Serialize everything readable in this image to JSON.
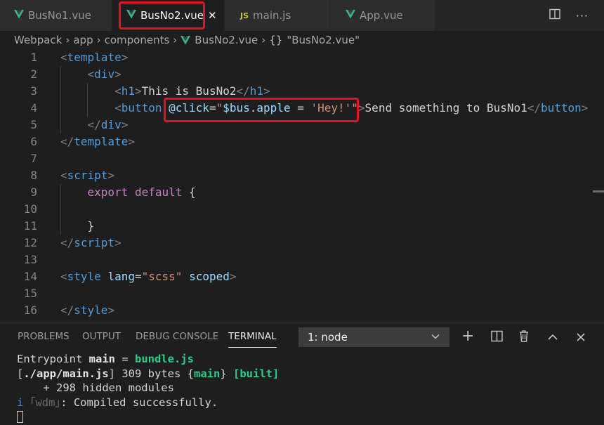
{
  "tabs": [
    {
      "label": "BusNo1.vue",
      "icon": "vue-icon",
      "active": false
    },
    {
      "label": "BusNo2.vue",
      "icon": "vue-icon",
      "active": true,
      "close": "✕"
    },
    {
      "label": "main.js",
      "icon": "js-icon",
      "icon_text": "JS",
      "active": false
    },
    {
      "label": "App.vue",
      "icon": "vue-icon",
      "active": false
    }
  ],
  "tab_actions": {
    "split": "split-editor-icon",
    "more": "···"
  },
  "breadcrumb": {
    "items": [
      "Webpack",
      "app",
      "components",
      "BusNo2.vue"
    ],
    "symbol": "\"BusNo2.vue\"",
    "symbol_icon": "{}",
    "separator": "›"
  },
  "editor": {
    "lines": [
      {
        "n": "1",
        "parts": [
          [
            "punc",
            "<"
          ],
          [
            "tag",
            "template"
          ],
          [
            "punc",
            ">"
          ]
        ]
      },
      {
        "n": "2",
        "parts": [
          [
            "txt",
            "    "
          ],
          [
            "punc",
            "<"
          ],
          [
            "tag",
            "div"
          ],
          [
            "punc",
            ">"
          ]
        ]
      },
      {
        "n": "3",
        "parts": [
          [
            "txt",
            "        "
          ],
          [
            "punc",
            "<"
          ],
          [
            "tag",
            "h1"
          ],
          [
            "punc",
            ">"
          ],
          [
            "txt",
            "This is BusNo2"
          ],
          [
            "punc",
            "</"
          ],
          [
            "tag",
            "h1"
          ],
          [
            "punc",
            ">"
          ]
        ]
      },
      {
        "n": "4",
        "parts": [
          [
            "txt",
            "        "
          ],
          [
            "punc",
            "<"
          ],
          [
            "tag",
            "button"
          ],
          [
            "txt",
            " "
          ],
          [
            "attr",
            "@click"
          ],
          [
            "txt",
            "="
          ],
          [
            "str",
            "\""
          ],
          [
            "attr",
            "$bus"
          ],
          [
            "txt",
            "."
          ],
          [
            "attr",
            "apple"
          ],
          [
            "txt",
            " = "
          ],
          [
            "str",
            "'Hey!'"
          ],
          [
            "str",
            "\""
          ],
          [
            "punc",
            ">"
          ],
          [
            "txt",
            "Send something to BusNo1"
          ],
          [
            "punc",
            "</"
          ],
          [
            "tag",
            "button"
          ],
          [
            "punc",
            ">"
          ]
        ]
      },
      {
        "n": "5",
        "parts": [
          [
            "txt",
            "    "
          ],
          [
            "punc",
            "</"
          ],
          [
            "tag",
            "div"
          ],
          [
            "punc",
            ">"
          ]
        ]
      },
      {
        "n": "6",
        "parts": [
          [
            "punc",
            "</"
          ],
          [
            "tag",
            "template"
          ],
          [
            "punc",
            ">"
          ]
        ]
      },
      {
        "n": "7",
        "parts": []
      },
      {
        "n": "8",
        "parts": [
          [
            "punc",
            "<"
          ],
          [
            "tag",
            "script"
          ],
          [
            "punc",
            ">"
          ]
        ]
      },
      {
        "n": "9",
        "parts": [
          [
            "txt",
            "    "
          ],
          [
            "kw",
            "export"
          ],
          [
            "txt",
            " "
          ],
          [
            "kw",
            "default"
          ],
          [
            "txt",
            " {"
          ]
        ]
      },
      {
        "n": "10",
        "parts": []
      },
      {
        "n": "11",
        "parts": [
          [
            "txt",
            "    }"
          ]
        ]
      },
      {
        "n": "12",
        "parts": [
          [
            "punc",
            "</"
          ],
          [
            "tag",
            "script"
          ],
          [
            "punc",
            ">"
          ]
        ]
      },
      {
        "n": "13",
        "parts": []
      },
      {
        "n": "14",
        "parts": [
          [
            "punc",
            "<"
          ],
          [
            "tag",
            "style"
          ],
          [
            "txt",
            " "
          ],
          [
            "attr",
            "lang"
          ],
          [
            "txt",
            "="
          ],
          [
            "str",
            "\"scss\""
          ],
          [
            "txt",
            " "
          ],
          [
            "attr",
            "scoped"
          ],
          [
            "punc",
            ">"
          ]
        ]
      },
      {
        "n": "15",
        "parts": []
      },
      {
        "n": "16",
        "parts": [
          [
            "punc",
            "</"
          ],
          [
            "tag",
            "style"
          ],
          [
            "punc",
            ">"
          ]
        ]
      }
    ]
  },
  "panel": {
    "tabs": [
      "PROBLEMS",
      "OUTPUT",
      "DEBUG CONSOLE",
      "TERMINAL"
    ],
    "active_tab": "TERMINAL",
    "terminal_select": "1: node",
    "actions": {
      "add": "+",
      "split": "split-terminal-icon",
      "trash": "trash-icon",
      "maximize": "^",
      "close": "✕"
    },
    "terminal_lines": [
      [
        [
          "txt",
          "Entrypoint "
        ],
        [
          "t-bold",
          "main"
        ],
        [
          "txt",
          " = "
        ],
        [
          "t-green",
          "bundle.js"
        ]
      ],
      [
        [
          "txt",
          "["
        ],
        [
          "t-bold",
          "./app/main.js"
        ],
        [
          "txt",
          "] 309 bytes {"
        ],
        [
          "t-green",
          "main"
        ],
        [
          "txt",
          "} "
        ],
        [
          "t-green",
          "[built]"
        ]
      ],
      [
        [
          "txt",
          "    + 298 hidden modules"
        ]
      ],
      [
        [
          "t-blue",
          "i"
        ],
        [
          "txt",
          " "
        ],
        [
          "t-dim",
          "｢wdm｣"
        ],
        [
          "txt",
          ": Compiled successfully."
        ]
      ]
    ]
  },
  "colors": {
    "highlight": "#e81123",
    "vue_green": "#41b883",
    "js_yellow": "#cbcb41"
  }
}
